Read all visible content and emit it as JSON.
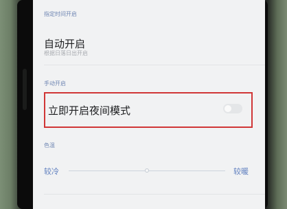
{
  "settings": {
    "scheduled_section": "指定时间开启",
    "auto_on_title": "自动开启",
    "auto_on_subtitle": "根据日落日出开启",
    "manual_section": "手动开启",
    "night_mode_label": "立即开启夜间模式",
    "night_mode_enabled": false,
    "color_temp_section": "色温",
    "color_temp_cool": "较冷",
    "color_temp_warm": "较暖",
    "color_temp_level": 0.5
  },
  "colors": {
    "section_header": "#6f86b3",
    "highlight": "#d03535",
    "accent": "#5f7fbf"
  }
}
